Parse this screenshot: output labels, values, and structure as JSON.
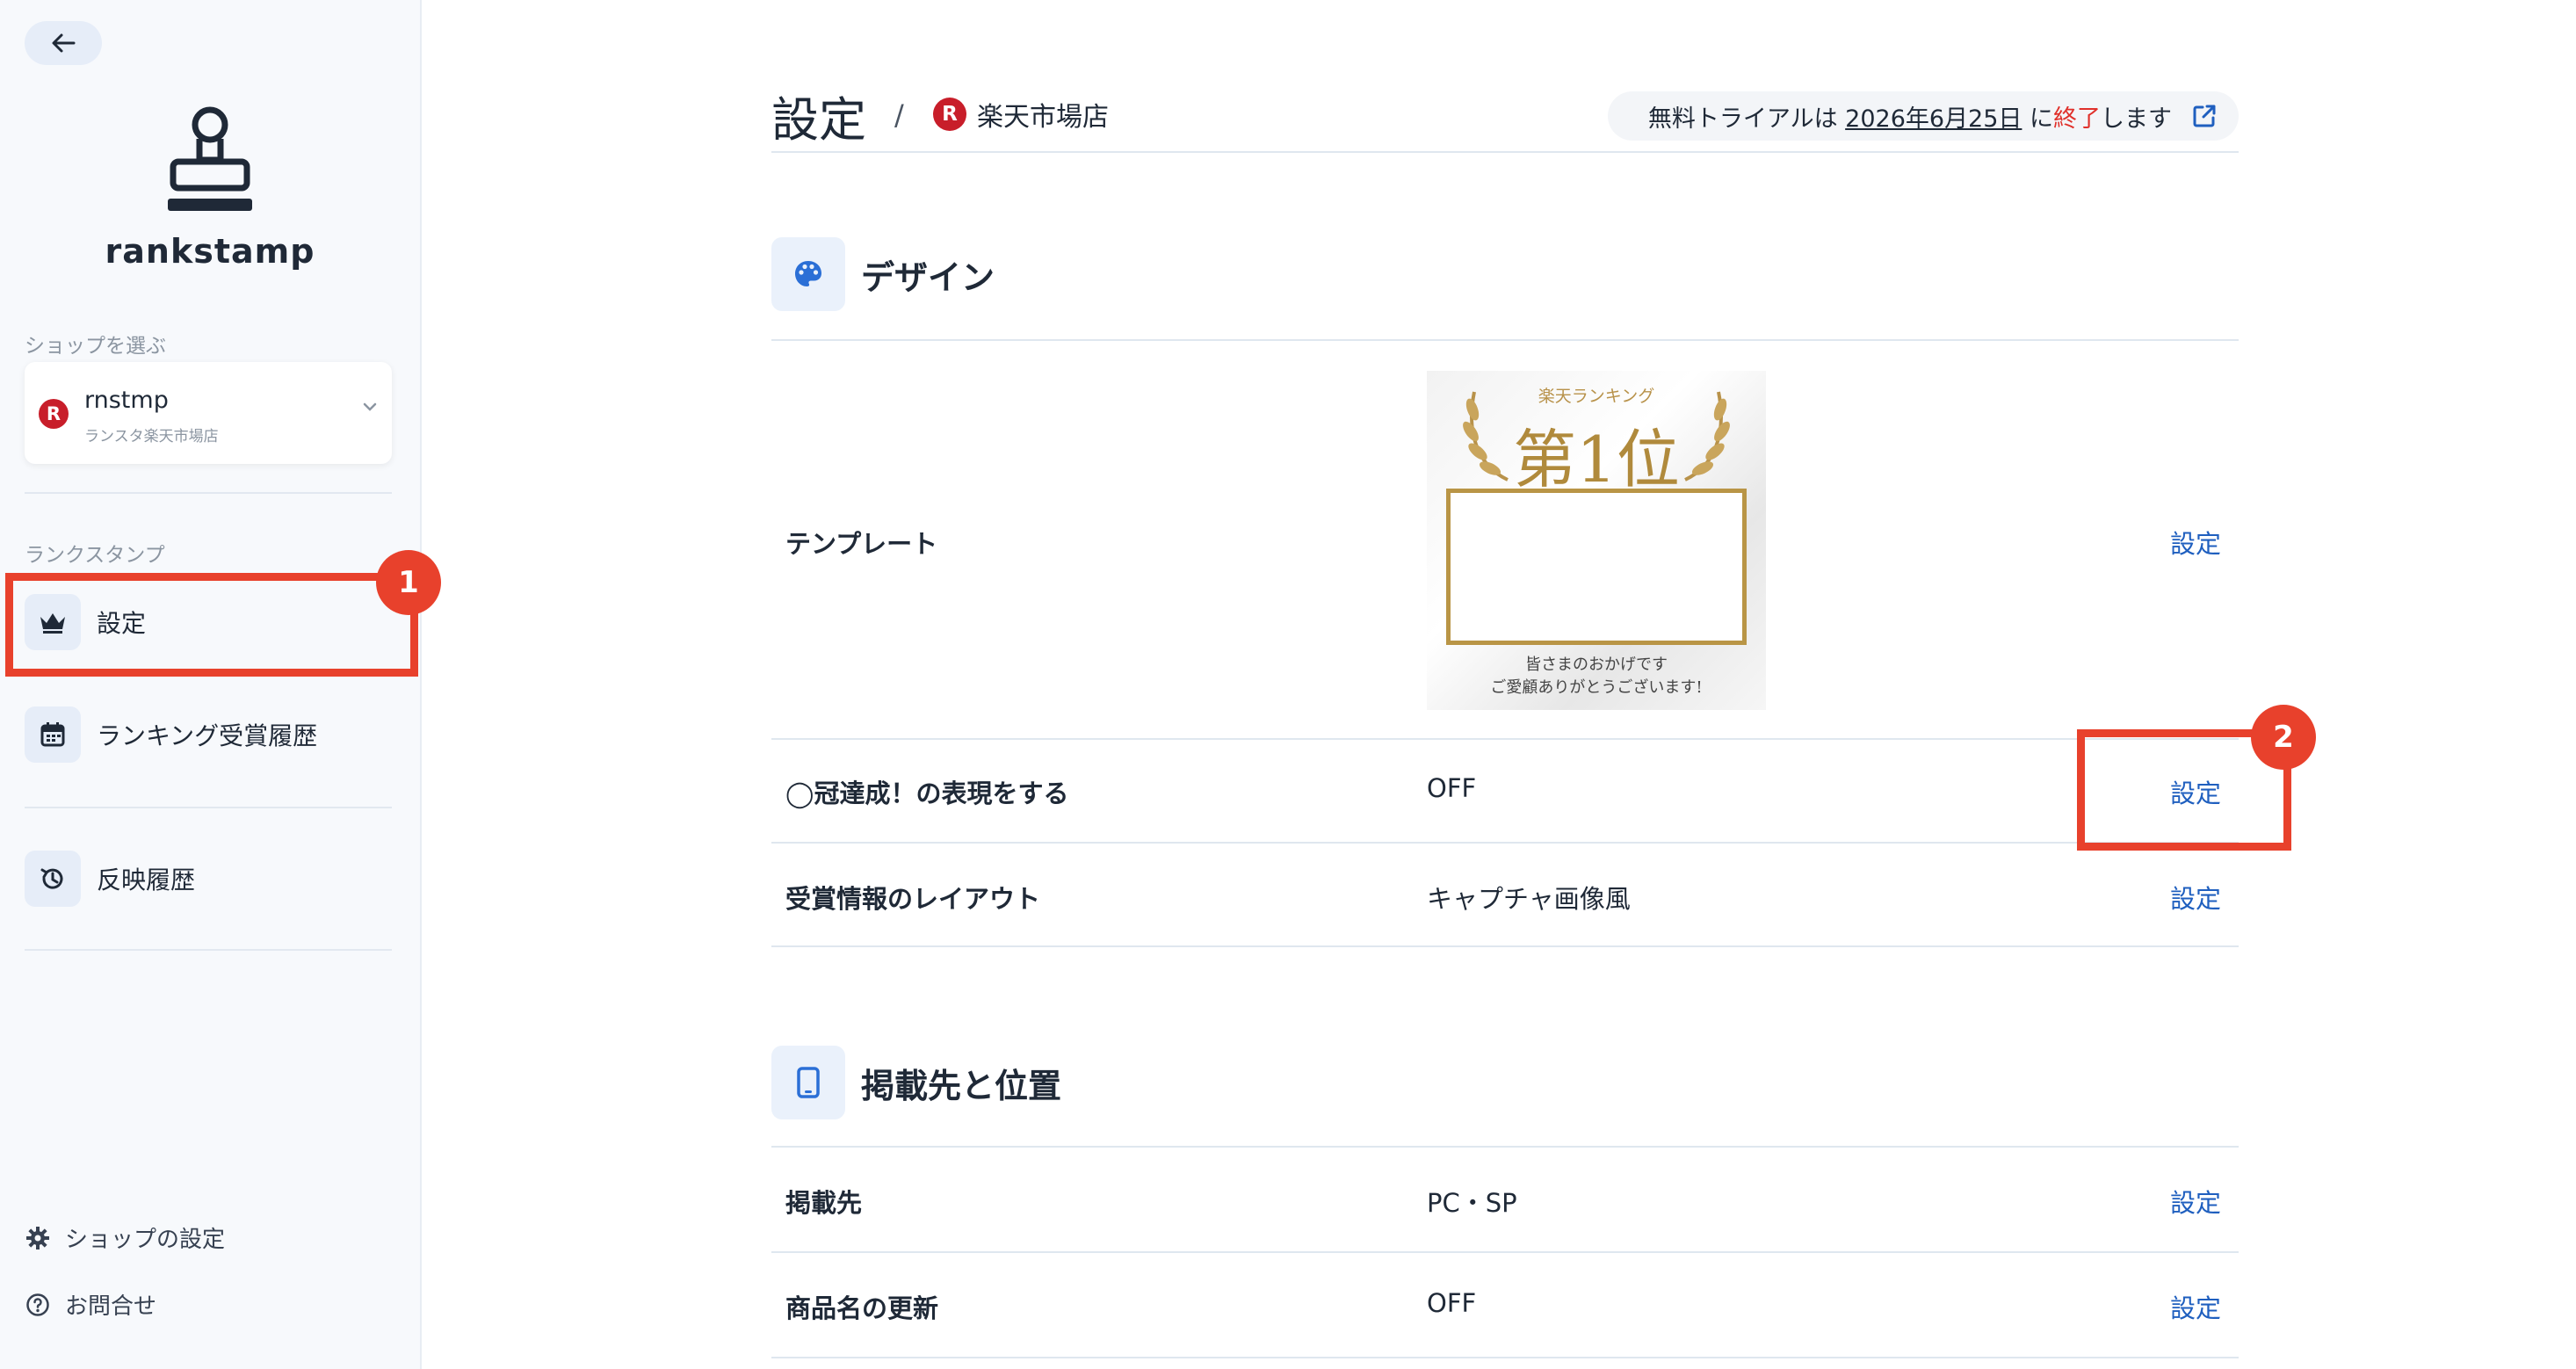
{
  "sidebar": {
    "logo_text": "rankstamp",
    "shop_section_label": "ショップを選ぶ",
    "shop": {
      "badge": "R",
      "name": "rnstmp",
      "sub": "ランスタ楽天市場店"
    },
    "stamp_section_label": "ランクスタンプ",
    "nav": [
      {
        "label": "設定",
        "icon": "crown-icon"
      },
      {
        "label": "ランキング受賞履歴",
        "icon": "calendar-icon"
      },
      {
        "label": "反映履歴",
        "icon": "history-icon"
      }
    ],
    "footer": [
      {
        "label": "ショップの設定",
        "icon": "gear-icon"
      },
      {
        "label": "お問合せ",
        "icon": "help-icon"
      }
    ]
  },
  "annotations": {
    "marker1": "1",
    "marker2": "2"
  },
  "header": {
    "title": "設定",
    "separator": "/",
    "shop_badge": "R",
    "shop_name": "楽天市場店",
    "trial": {
      "prefix": "無料トライアルは ",
      "date": "2026年6月25日",
      "mid": " に",
      "end_word": "終了",
      "suffix": "します"
    }
  },
  "design": {
    "title": "デザイン",
    "icon": "palette-icon",
    "rows": [
      {
        "label": "テンプレート",
        "action": "設定"
      },
      {
        "label": "◯冠達成！の表現をする",
        "value": "OFF",
        "action": "設定"
      },
      {
        "label": "受賞情報のレイアウト",
        "value": "キャプチャ画像風",
        "action": "設定"
      }
    ],
    "template_preview": {
      "top": "楽天ランキング",
      "rank": "第1位",
      "message1": "皆さまのおかげです",
      "message2": "ご愛顧ありがとうございます!"
    }
  },
  "placement": {
    "title": "掲載先と位置",
    "icon": "smartphone-icon",
    "rows": [
      {
        "label": "掲載先",
        "value": "PC・SP",
        "action": "設定"
      },
      {
        "label": "商品名の更新",
        "value": "OFF",
        "action": "設定"
      }
    ]
  },
  "colors": {
    "accent": "#1f5fbf",
    "annotation": "#e8412c",
    "rakuten": "#c81e2a",
    "trial_end": "#e0302a"
  }
}
